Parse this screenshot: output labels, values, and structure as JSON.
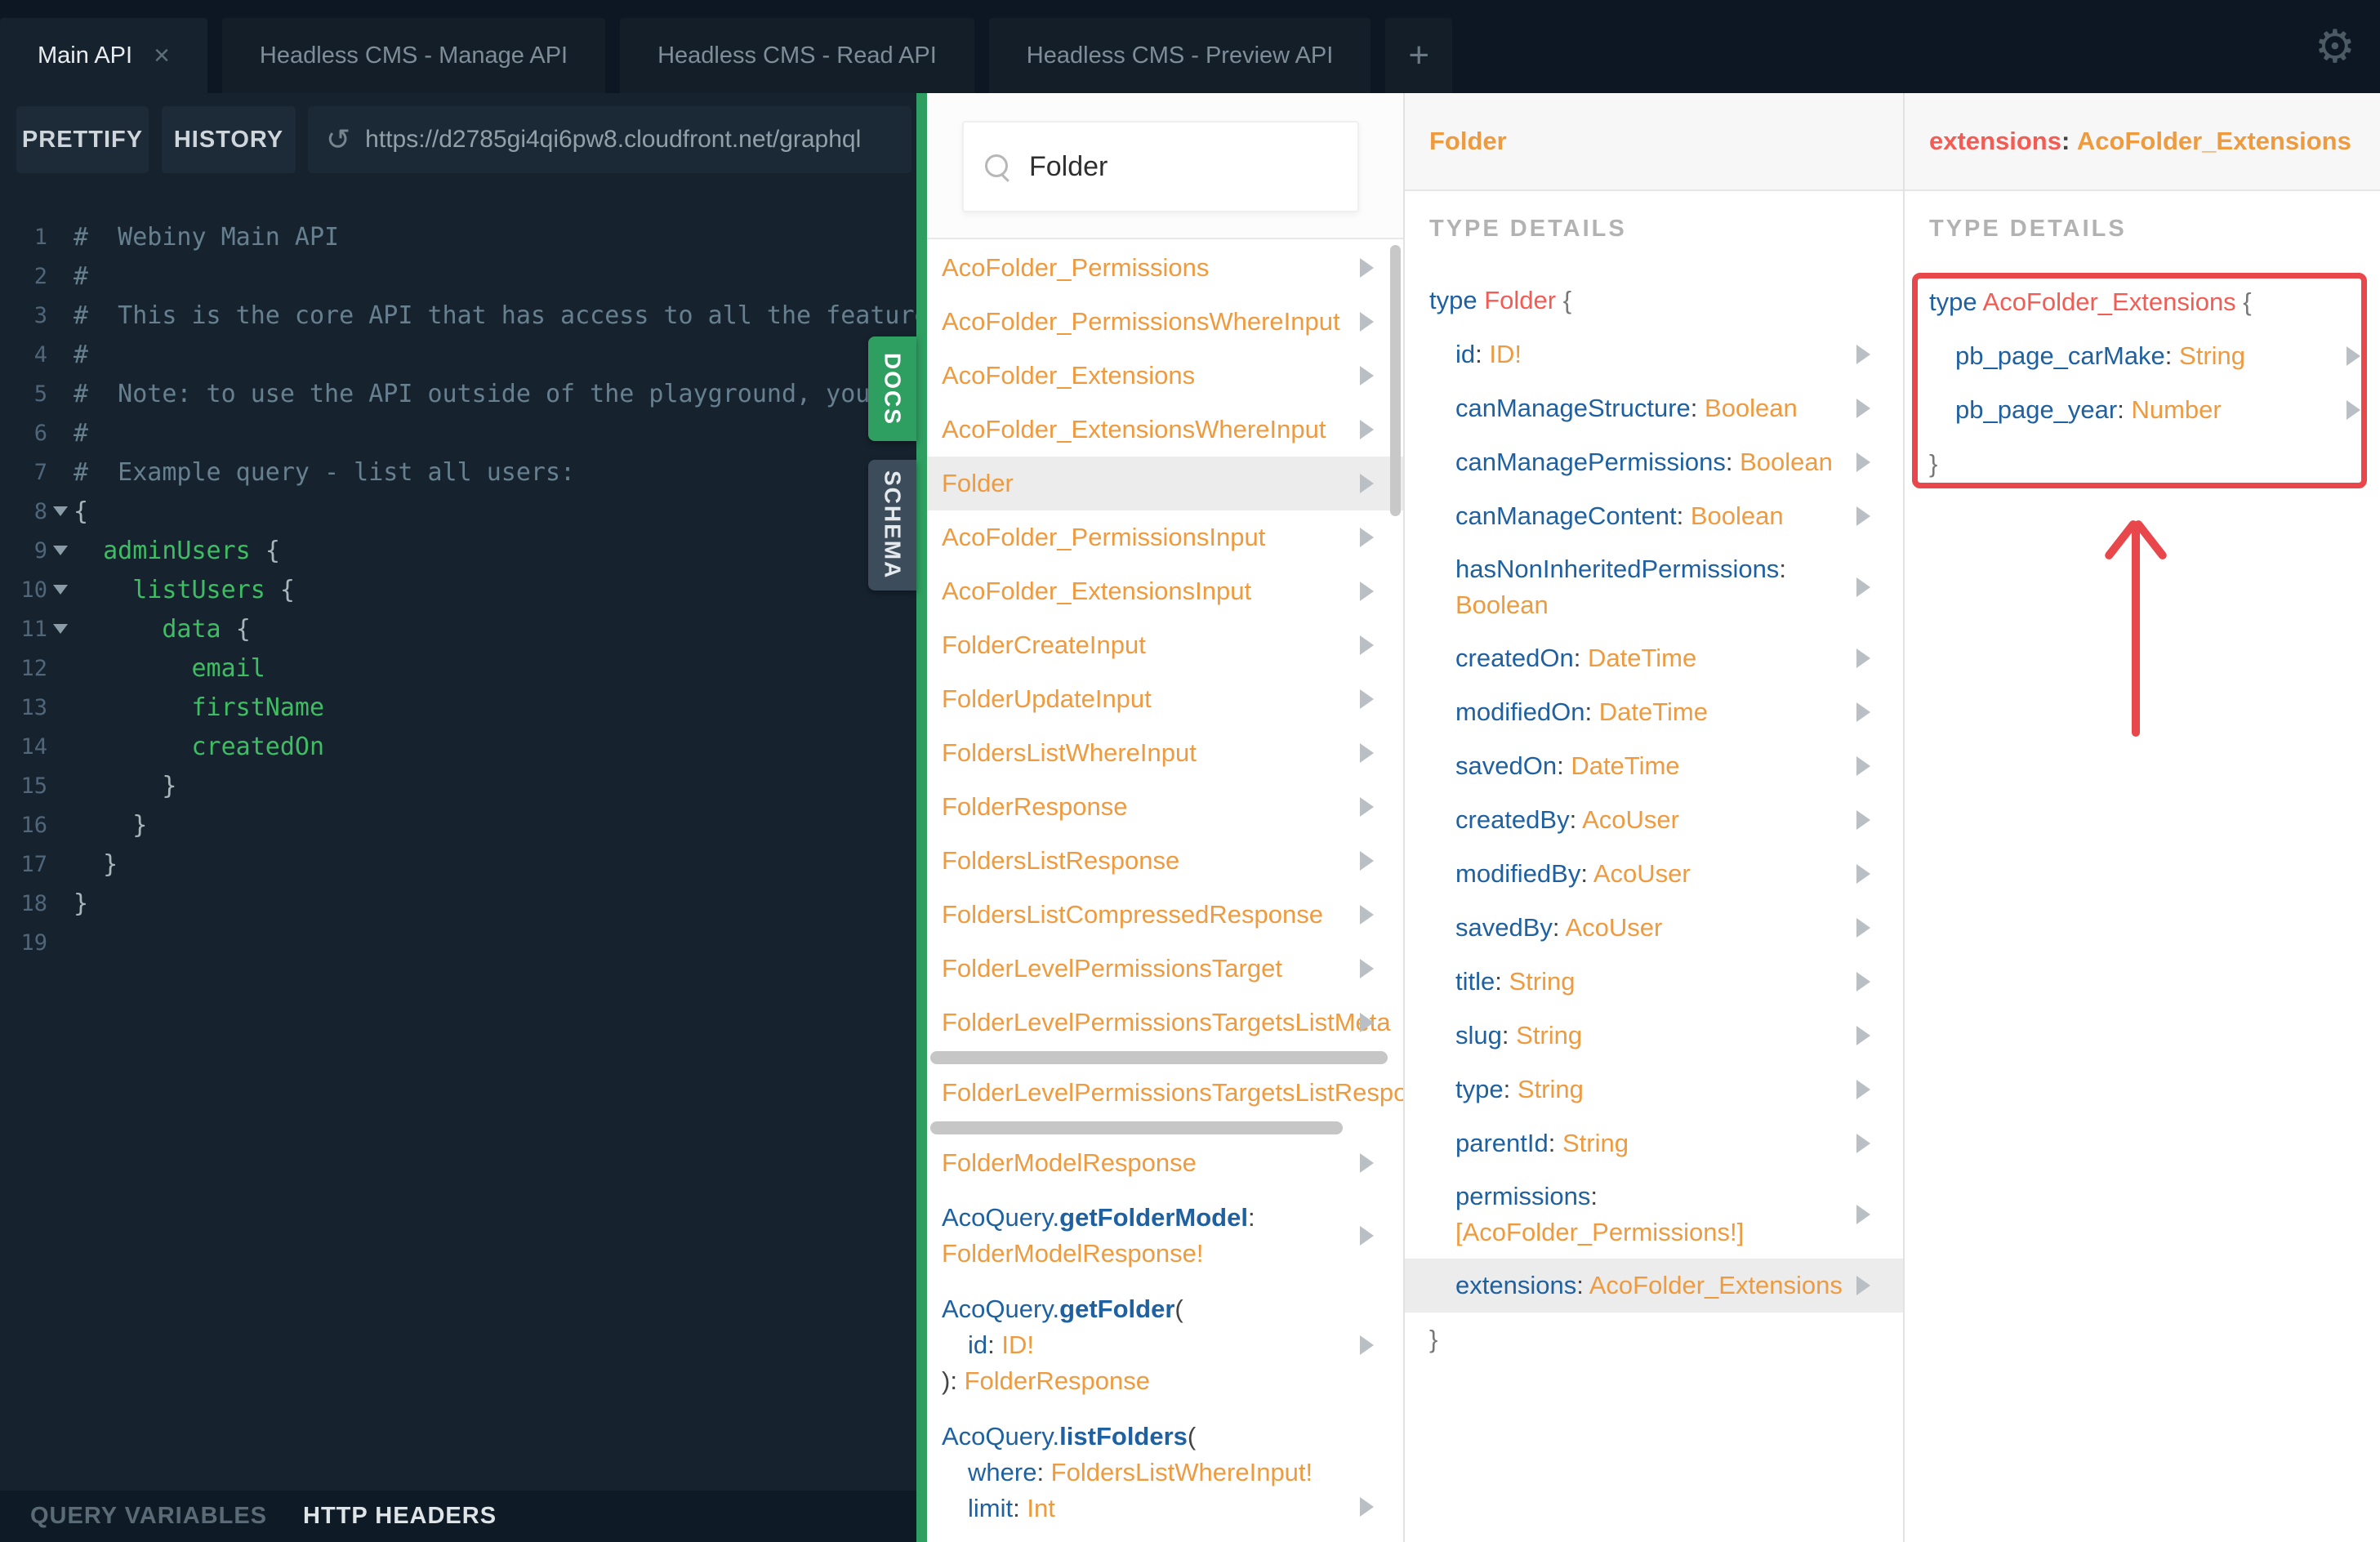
{
  "colors": {
    "topbar_bg": "#0d1723",
    "panel_bg": "#16222e",
    "accent_green": "#2e9e61",
    "schema_tab_bg": "#3d4c5a",
    "list_orange": "#ee9b40",
    "field_blue": "#1f61a0",
    "type_red": "#f25c54",
    "code_green": "#3fbd63",
    "comment_gray": "#66808f",
    "annotation_red": "#e8484b",
    "highlight_row": "#ececec"
  },
  "tabbar": {
    "tabs": [
      {
        "label": "Main API",
        "active": true,
        "closable": true
      },
      {
        "label": "Headless CMS - Manage API",
        "active": false,
        "closable": false
      },
      {
        "label": "Headless CMS - Read API",
        "active": false,
        "closable": false
      },
      {
        "label": "Headless CMS - Preview API",
        "active": false,
        "closable": false
      }
    ],
    "add_label": "+",
    "close_label": "×",
    "gear_icon": "gear"
  },
  "toolbar": {
    "prettify_label": "PRETTIFY",
    "history_label": "HISTORY",
    "reload_icon": "↺",
    "url": "https://d2785gi4qi6pw8.cloudfront.net/graphql"
  },
  "side_tabs": {
    "docs": "DOCS",
    "schema": "SCHEMA"
  },
  "bottom_bar": {
    "query_variables": "QUERY VARIABLES",
    "http_headers": "HTTP HEADERS"
  },
  "editor": {
    "lines": [
      {
        "n": 1,
        "fold": false,
        "segs": [
          [
            "#  Webiny Main API",
            "cm"
          ]
        ]
      },
      {
        "n": 2,
        "fold": false,
        "segs": [
          [
            "#",
            "cm"
          ]
        ]
      },
      {
        "n": 3,
        "fold": false,
        "segs": [
          [
            "#  This is the core API that has access to all the features",
            "cm"
          ]
        ]
      },
      {
        "n": 4,
        "fold": false,
        "segs": [
          [
            "#",
            "cm"
          ]
        ]
      },
      {
        "n": 5,
        "fold": false,
        "segs": [
          [
            "#  Note: to use the API outside of the playground, you will",
            "cm"
          ]
        ]
      },
      {
        "n": 6,
        "fold": false,
        "segs": [
          [
            "#",
            "cm"
          ]
        ]
      },
      {
        "n": 7,
        "fold": false,
        "segs": [
          [
            "#  Example query - list all users:",
            "cm"
          ]
        ]
      },
      {
        "n": 8,
        "fold": true,
        "segs": [
          [
            "{",
            "pn"
          ]
        ]
      },
      {
        "n": 9,
        "fold": true,
        "segs": [
          [
            "  ",
            "sp"
          ],
          [
            "adminUsers",
            "fld"
          ],
          [
            " ",
            "sp"
          ],
          [
            "{",
            "pn"
          ]
        ]
      },
      {
        "n": 10,
        "fold": true,
        "segs": [
          [
            "    ",
            "sp"
          ],
          [
            "listUsers",
            "fld"
          ],
          [
            " ",
            "sp"
          ],
          [
            "{",
            "pn"
          ]
        ]
      },
      {
        "n": 11,
        "fold": true,
        "segs": [
          [
            "      ",
            "sp"
          ],
          [
            "data",
            "fld"
          ],
          [
            " ",
            "sp"
          ],
          [
            "{",
            "pn"
          ]
        ]
      },
      {
        "n": 12,
        "fold": false,
        "segs": [
          [
            "        ",
            "sp"
          ],
          [
            "email",
            "fld"
          ]
        ]
      },
      {
        "n": 13,
        "fold": false,
        "segs": [
          [
            "        ",
            "sp"
          ],
          [
            "firstName",
            "fld"
          ]
        ]
      },
      {
        "n": 14,
        "fold": false,
        "segs": [
          [
            "        ",
            "sp"
          ],
          [
            "createdOn",
            "fld"
          ]
        ]
      },
      {
        "n": 15,
        "fold": false,
        "segs": [
          [
            "      ",
            "sp"
          ],
          [
            "}",
            "pn"
          ]
        ]
      },
      {
        "n": 16,
        "fold": false,
        "segs": [
          [
            "    ",
            "sp"
          ],
          [
            "}",
            "pn"
          ]
        ]
      },
      {
        "n": 17,
        "fold": false,
        "segs": [
          [
            "  ",
            "sp"
          ],
          [
            "}",
            "pn"
          ]
        ]
      },
      {
        "n": 18,
        "fold": false,
        "segs": [
          [
            "}",
            "pn"
          ]
        ]
      },
      {
        "n": 19,
        "fold": false,
        "segs": []
      }
    ]
  },
  "docs_panel": {
    "search_value": "Folder",
    "search_icon": "magnifier",
    "items": [
      {
        "lines": [
          [
            [
              "AcoFolder_Permissions",
              "or"
            ]
          ]
        ],
        "arrow": true
      },
      {
        "lines": [
          [
            [
              "AcoFolder_PermissionsWhereInput",
              "or"
            ]
          ]
        ],
        "arrow": true
      },
      {
        "lines": [
          [
            [
              "AcoFolder_Extensions",
              "or"
            ]
          ]
        ],
        "arrow": true
      },
      {
        "lines": [
          [
            [
              "AcoFolder_ExtensionsWhereInput",
              "or"
            ]
          ]
        ],
        "arrow": true
      },
      {
        "lines": [
          [
            [
              "Folder",
              "or"
            ]
          ]
        ],
        "arrow": true,
        "highlight": true
      },
      {
        "lines": [
          [
            [
              "AcoFolder_PermissionsInput",
              "or"
            ]
          ]
        ],
        "arrow": true
      },
      {
        "lines": [
          [
            [
              "AcoFolder_ExtensionsInput",
              "or"
            ]
          ]
        ],
        "arrow": true
      },
      {
        "lines": [
          [
            [
              "FolderCreateInput",
              "or"
            ]
          ]
        ],
        "arrow": true
      },
      {
        "lines": [
          [
            [
              "FolderUpdateInput",
              "or"
            ]
          ]
        ],
        "arrow": true
      },
      {
        "lines": [
          [
            [
              "FoldersListWhereInput",
              "or"
            ]
          ]
        ],
        "arrow": true
      },
      {
        "lines": [
          [
            [
              "FolderResponse",
              "or"
            ]
          ]
        ],
        "arrow": true
      },
      {
        "lines": [
          [
            [
              "FoldersListResponse",
              "or"
            ]
          ]
        ],
        "arrow": true
      },
      {
        "lines": [
          [
            [
              "FoldersListCompressedResponse",
              "or"
            ]
          ]
        ],
        "arrow": true
      },
      {
        "lines": [
          [
            [
              "FolderLevelPermissionsTarget",
              "or"
            ]
          ]
        ],
        "arrow": true
      },
      {
        "lines": [
          [
            [
              "FolderLevelPermissionsTargetsListMeta",
              "or"
            ]
          ]
        ],
        "arrow": true,
        "hbar": 560
      },
      {
        "lines": [
          [
            [
              "FolderLevelPermissionsTargetsListRespo",
              "or"
            ]
          ]
        ],
        "arrow": false,
        "hbar": 505
      },
      {
        "lines": [
          [
            [
              "FolderModelResponse",
              "or"
            ]
          ]
        ],
        "arrow": true
      },
      {
        "lines": [
          [
            [
              "AcoQuery.",
              "fl"
            ],
            [
              "getFolderModel",
              "fb"
            ],
            [
              ":",
              "pl"
            ]
          ],
          [
            [
              "FolderModelResponse!",
              "or"
            ]
          ]
        ],
        "arrow": true
      },
      {
        "lines": [
          [
            [
              "AcoQuery.",
              "fl"
            ],
            [
              "getFolder",
              "fb"
            ],
            [
              "(",
              "pl"
            ]
          ],
          {
            "ind": true,
            "segs": [
              [
                "id",
                "fl"
              ],
              [
                ": ",
                "pl"
              ],
              [
                "ID!",
                "or"
              ]
            ]
          },
          [
            [
              "): ",
              "pl"
            ],
            [
              "FolderResponse",
              "or"
            ]
          ]
        ],
        "arrow": true
      },
      {
        "lines": [
          [
            [
              "AcoQuery.",
              "fl"
            ],
            [
              "listFolders",
              "fb"
            ],
            [
              "(",
              "pl"
            ]
          ],
          {
            "ind": true,
            "segs": [
              [
                "where",
                "fl"
              ],
              [
                ": ",
                "pl"
              ],
              [
                "FoldersListWhereInput!",
                "or"
              ]
            ]
          },
          {
            "ind": true,
            "segs": [
              [
                "limit",
                "fl"
              ],
              [
                ": ",
                "pl"
              ],
              [
                "Int",
                "or"
              ]
            ]
          }
        ],
        "arrow": "bottom"
      }
    ]
  },
  "type_panel": {
    "title": "Folder",
    "section_label": "TYPE DETAILS",
    "decl_segs": [
      [
        "type",
        "kw"
      ],
      [
        " ",
        "pl"
      ],
      [
        "Folder",
        "tn"
      ],
      [
        " {",
        "br"
      ]
    ],
    "fields": [
      {
        "lines": [
          [
            [
              "id",
              "fl"
            ],
            [
              ": ",
              "pl"
            ],
            [
              "ID!",
              "or"
            ]
          ]
        ],
        "arrow": true
      },
      {
        "lines": [
          [
            [
              "canManageStructure",
              "fl"
            ],
            [
              ": ",
              "pl"
            ],
            [
              "Boolean",
              "or"
            ]
          ]
        ],
        "arrow": true
      },
      {
        "lines": [
          [
            [
              "canManagePermissions",
              "fl"
            ],
            [
              ": ",
              "pl"
            ],
            [
              "Boolean",
              "or"
            ]
          ]
        ],
        "arrow": true
      },
      {
        "lines": [
          [
            [
              "canManageContent",
              "fl"
            ],
            [
              ": ",
              "pl"
            ],
            [
              "Boolean",
              "or"
            ]
          ]
        ],
        "arrow": true
      },
      {
        "lines": [
          [
            [
              "hasNonInheritedPermissions",
              "fl"
            ],
            [
              ":",
              "pl"
            ]
          ],
          [
            [
              "Boolean",
              "or"
            ]
          ]
        ],
        "arrow": true
      },
      {
        "lines": [
          [
            [
              "createdOn",
              "fl"
            ],
            [
              ": ",
              "pl"
            ],
            [
              "DateTime",
              "or"
            ]
          ]
        ],
        "arrow": true
      },
      {
        "lines": [
          [
            [
              "modifiedOn",
              "fl"
            ],
            [
              ": ",
              "pl"
            ],
            [
              "DateTime",
              "or"
            ]
          ]
        ],
        "arrow": true
      },
      {
        "lines": [
          [
            [
              "savedOn",
              "fl"
            ],
            [
              ": ",
              "pl"
            ],
            [
              "DateTime",
              "or"
            ]
          ]
        ],
        "arrow": true
      },
      {
        "lines": [
          [
            [
              "createdBy",
              "fl"
            ],
            [
              ": ",
              "pl"
            ],
            [
              "AcoUser",
              "or"
            ]
          ]
        ],
        "arrow": true
      },
      {
        "lines": [
          [
            [
              "modifiedBy",
              "fl"
            ],
            [
              ": ",
              "pl"
            ],
            [
              "AcoUser",
              "or"
            ]
          ]
        ],
        "arrow": true
      },
      {
        "lines": [
          [
            [
              "savedBy",
              "fl"
            ],
            [
              ": ",
              "pl"
            ],
            [
              "AcoUser",
              "or"
            ]
          ]
        ],
        "arrow": true
      },
      {
        "lines": [
          [
            [
              "title",
              "fl"
            ],
            [
              ": ",
              "pl"
            ],
            [
              "String",
              "or"
            ]
          ]
        ],
        "arrow": true
      },
      {
        "lines": [
          [
            [
              "slug",
              "fl"
            ],
            [
              ": ",
              "pl"
            ],
            [
              "String",
              "or"
            ]
          ]
        ],
        "arrow": true
      },
      {
        "lines": [
          [
            [
              "type",
              "fl"
            ],
            [
              ": ",
              "pl"
            ],
            [
              "String",
              "or"
            ]
          ]
        ],
        "arrow": true
      },
      {
        "lines": [
          [
            [
              "parentId",
              "fl"
            ],
            [
              ": ",
              "pl"
            ],
            [
              "String",
              "or"
            ]
          ]
        ],
        "arrow": true
      },
      {
        "lines": [
          [
            [
              "permissions",
              "fl"
            ],
            [
              ":",
              "pl"
            ]
          ],
          [
            [
              "[AcoFolder_Permissions!]",
              "or"
            ]
          ]
        ],
        "arrow": true
      },
      {
        "lines": [
          [
            [
              "extensions",
              "fl"
            ],
            [
              ": ",
              "pl"
            ],
            [
              "AcoFolder_Extensions",
              "or"
            ]
          ]
        ],
        "arrow": true,
        "highlight": true
      }
    ],
    "close_brace": "}"
  },
  "ext_panel": {
    "title_segs": [
      [
        "extensions",
        "tn"
      ],
      [
        ": ",
        "pl"
      ],
      [
        "AcoFolder_Extensions",
        "fl"
      ]
    ],
    "section_label": "TYPE DETAILS",
    "decl_segs": [
      [
        "type",
        "kw"
      ],
      [
        " ",
        "pl"
      ],
      [
        "AcoFolder_Extensions",
        "tn"
      ],
      [
        " {",
        "br"
      ]
    ],
    "fields": [
      {
        "lines": [
          [
            [
              "pb_page_carMake",
              "fl"
            ],
            [
              ": ",
              "pl"
            ],
            [
              "String",
              "or"
            ]
          ]
        ],
        "arrow": true
      },
      {
        "lines": [
          [
            [
              "pb_page_year",
              "fl"
            ],
            [
              ": ",
              "pl"
            ],
            [
              "Number",
              "or"
            ]
          ]
        ],
        "arrow": true
      }
    ],
    "close_brace": "}",
    "annotation": {
      "shape": "box-and-up-arrow",
      "color": "#e8484b"
    }
  }
}
